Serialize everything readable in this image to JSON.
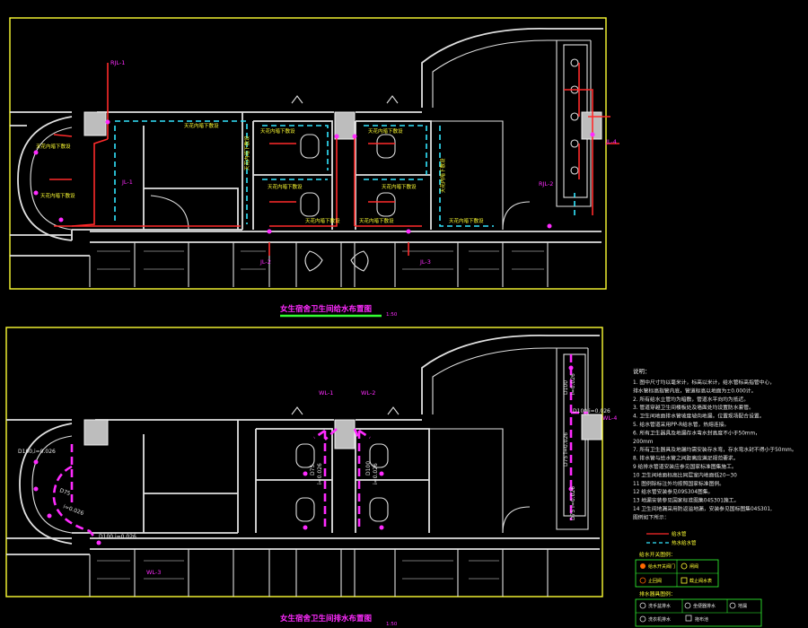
{
  "colors": {
    "background": "#000000",
    "frame": "#ffff33",
    "label": "#ff2bff",
    "supply_pipe": "#ff2b2b",
    "hot_pipe": "#33e6ff",
    "drain_pipe": "#ff2bff"
  },
  "top_plan": {
    "title": "女生宿舍卫生间给水布置图",
    "scale": "1:50",
    "risers": {
      "rjl1": "RJL-1",
      "jl1": "JL-1",
      "jl2": "JL-2",
      "jl3": "JL-3",
      "rjl2": "RJL-2",
      "jl4": "JL-4"
    },
    "notes": {
      "n1": "天花内暗下敷设",
      "n2": "天花内暗下敷设",
      "n3": "天花内暗下敷设",
      "n4": "天花内暗下敷设",
      "n5": "天花内暗下敷设",
      "n6": "天花内暗下敷设",
      "n7": "天花内暗下敷设",
      "n8": "天花内暗下敷设",
      "n9": "天花内暗下敷设",
      "n10": "天花内暗下敷设",
      "n11": "天花内暗下敷设",
      "n12": "天花内暗下敷设"
    }
  },
  "bottom_plan": {
    "title": "女生宿舍卫生间排水布置图",
    "scale": "1:50",
    "risers": {
      "wl1": "WL-1",
      "wl2": "WL-2",
      "wl3": "WL-3",
      "wl4": "WL-4"
    },
    "pipe_labels": {
      "p1": "D100,i=0.026",
      "p2": "D100,i=0.026",
      "p3": "D75",
      "p4": "i=0.026",
      "p5": "D75",
      "p6": "i=0.026",
      "p7": "D100",
      "p8": "i=0.026",
      "p9": "D100",
      "p10": "i=0.026",
      "p11": "D75 i=0.026",
      "p12": "D75 i=0.026",
      "p13": "D100,i=0.026"
    }
  },
  "notes_panel": {
    "heading": "说明：",
    "lines": [
      "1. 图中尺寸均以毫米计，标高以米计，给水管标高指管中心，",
      "排水管标高指管内底，管道标高以地面为±0.000计。",
      "2. 所有给水立管均为暗敷，管道水平向均为抵近。",
      "3. 管道穿越卫生间楼板处及墙面处均设置防水套管。",
      "4. 卫生间地面排水管坡度坡向地漏，位置现场配合设置。",
      "5. 给水管道采用PP-R给水管，热熔连接。",
      "6. 所有卫生器具及地漏存水弯水封高度不小于50mm，",
      "200mm",
      "7. 所有卫生器具及地漏均需安装存水弯，存水弯水封不得小于50mm。",
      "8. 排水管与给水管之间距离应满足规范要求。",
      "9 给排水管道安装应参见国家标准图集施工。",
      "10 卫生间地面标高比同层室内地面低20~30",
      "11 图例除标注外均按照国家标准图例。",
      "12 给水管安装参见09S304图集。",
      "13 地漏安装参见国家标准图集04S301施工。",
      "14 卫生间地漏采用防返溢地漏，安装参见国标图集04S301,",
      "    图例如下所示："
    ],
    "legend_lines": [
      {
        "label": "给水管"
      },
      {
        "label": "热水给水管"
      }
    ],
    "legend2_heading": "给水开关图例：",
    "legend2": [
      {
        "label": "给水开关阀门"
      },
      {
        "label": "闸阀"
      },
      {
        "label": "止回阀"
      },
      {
        "label": "截止阀水表"
      }
    ],
    "legend3_heading": "排水器具图例：",
    "legend3": [
      {
        "label": "洗手盆排水"
      },
      {
        "label": "洗衣机排水"
      },
      {
        "label": "坐便器排水"
      },
      {
        "label": "地漏"
      },
      {
        "label": "拖布池"
      }
    ]
  }
}
